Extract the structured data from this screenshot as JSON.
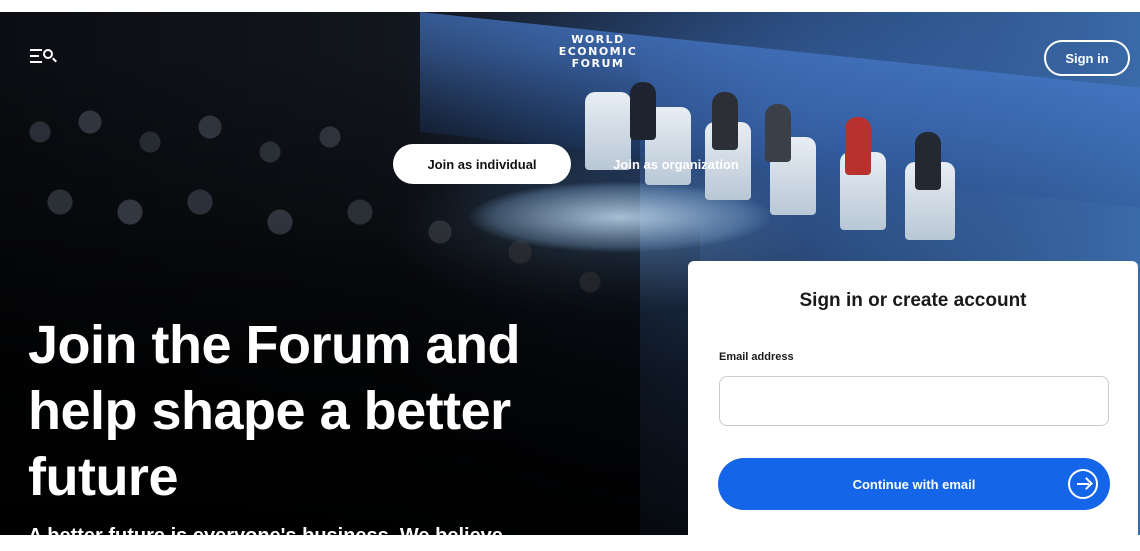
{
  "header": {
    "logo_lines": [
      "WORLD",
      "ECONOMIC",
      "FORUM"
    ],
    "sign_in_label": "Sign in"
  },
  "join_toggle": {
    "individual_label": "Join as individual",
    "organization_label": "Join as organization",
    "selected": "individual"
  },
  "hero": {
    "title_lines": [
      "Join the Forum and",
      "help shape a better",
      "future"
    ],
    "subtitle": "A better future is everyone's business. We believe"
  },
  "signin_card": {
    "title": "Sign in or create account",
    "email_label": "Email address",
    "email_value": "",
    "continue_label": "Continue with email"
  },
  "colors": {
    "primary_button": "#1565e8",
    "card_background": "#ffffff",
    "hero_text": "#ffffff"
  },
  "icons": {
    "menu": "menu-search-icon",
    "continue": "arrow-right-circle-icon"
  }
}
